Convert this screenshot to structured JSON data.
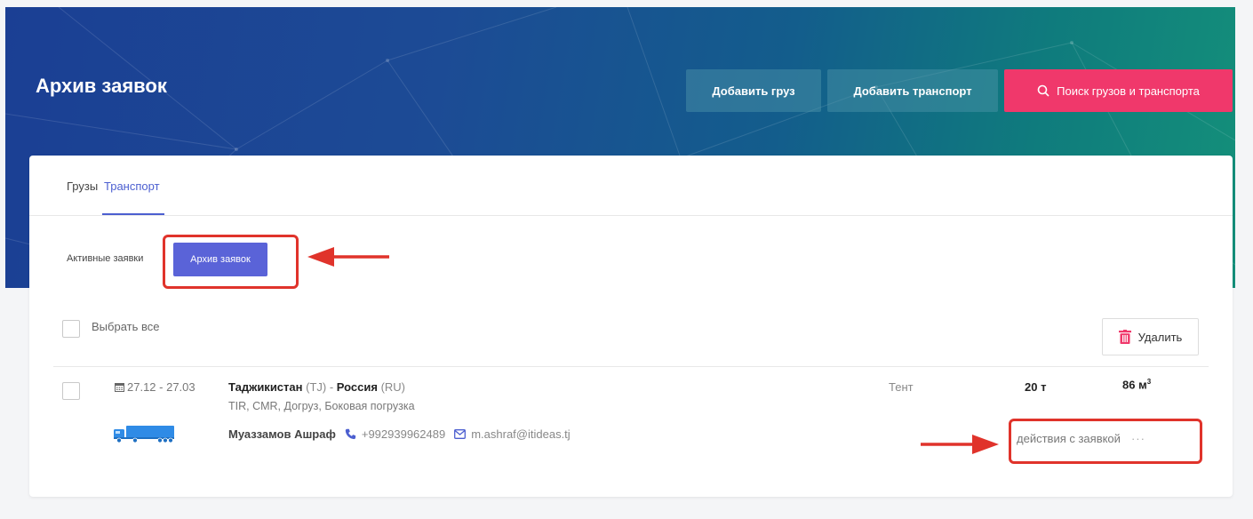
{
  "header": {
    "title": "Архив заявок",
    "add_cargo": "Добавить груз",
    "add_transport": "Добавить транспорт",
    "search": "Поиск грузов и транспорта"
  },
  "tabs": {
    "cargo": "Грузы",
    "transport": "Транспорт"
  },
  "subtabs": {
    "active": "Активные заявки",
    "archive": "Архив заявок"
  },
  "list": {
    "select_all": "Выбрать все",
    "delete": "Удалить"
  },
  "entry": {
    "date": "27.12 - 27.03",
    "from_country": "Таджикистан",
    "from_code": "(TJ)",
    "separator": " - ",
    "to_country": "Россия",
    "to_code": "(RU)",
    "details": "TIR, CMR, Догруз, Боковая погрузка",
    "truck_type": "Тент",
    "weight": "20 т",
    "volume": "86 м",
    "volume_sup": "3",
    "contact_name": "Муаззамов Ашраф",
    "phone": "+992939962489",
    "email": "m.ashraf@itideas.tj",
    "actions": "действия с заявкой",
    "actions_more": "···"
  },
  "colors": {
    "accent": "#5a63d8",
    "pink": "#f0386b",
    "annotation_red": "#e0332b",
    "truck_blue": "#2f8be6"
  }
}
